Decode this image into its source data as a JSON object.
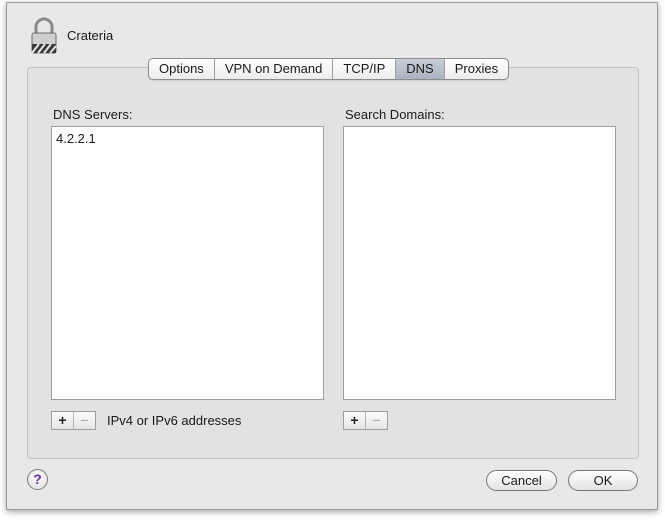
{
  "window": {
    "connection_name": "Crateria"
  },
  "tabs": [
    {
      "label": "Options",
      "active": false
    },
    {
      "label": "VPN on Demand",
      "active": false
    },
    {
      "label": "TCP/IP",
      "active": false
    },
    {
      "label": "DNS",
      "active": true
    },
    {
      "label": "Proxies",
      "active": false
    }
  ],
  "dns_servers": {
    "label": "DNS Servers:",
    "items": [
      "4.2.2.1"
    ],
    "add_label": "+",
    "remove_label": "−",
    "hint": "IPv4 or IPv6 addresses"
  },
  "search_domains": {
    "label": "Search Domains:",
    "items": [],
    "add_label": "+",
    "remove_label": "−"
  },
  "footer": {
    "help_label": "?",
    "cancel_label": "Cancel",
    "ok_label": "OK"
  },
  "icons": {
    "lock": "lock-icon",
    "help": "help-icon"
  }
}
